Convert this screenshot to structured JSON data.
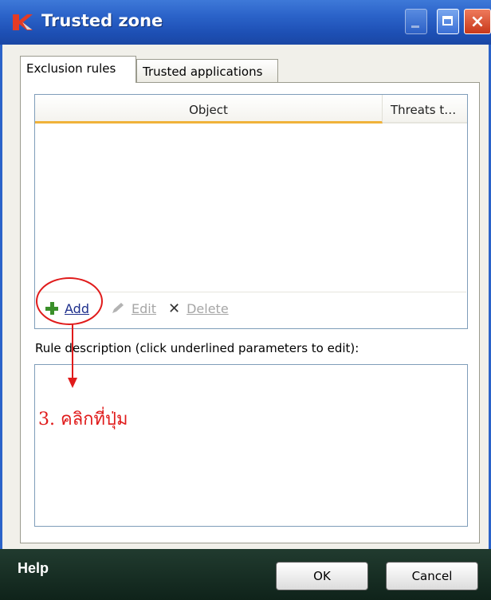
{
  "window": {
    "title": "Trusted zone",
    "logo_icon": "kaspersky-k-logo"
  },
  "tabs": [
    {
      "label": "Exclusion rules",
      "active": true
    },
    {
      "label": "Trusted applications",
      "active": false
    }
  ],
  "table": {
    "columns": [
      "Object",
      "Threats t…"
    ],
    "rows": []
  },
  "toolbar": {
    "add_label": "Add",
    "edit_label": "Edit",
    "delete_label": "Delete"
  },
  "description": {
    "label": "Rule description (click underlined parameters to edit):",
    "content": ""
  },
  "annotation": {
    "text": "3. คลิกที่ปุ่ม",
    "color": "#e01b1b"
  },
  "footer": {
    "help_label": "Help",
    "ok_label": "OK",
    "cancel_label": "Cancel"
  },
  "colors": {
    "titlebar": "#2b63c9",
    "footer": "#1a3226",
    "add_green": "#3a8f2a",
    "header_underline": "#f0b23a"
  }
}
